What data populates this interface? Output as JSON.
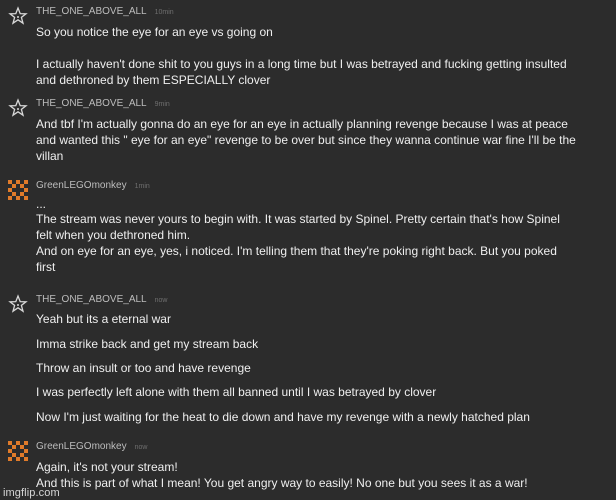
{
  "comments": [
    {
      "username": "THE_ONE_ABOVE_ALL",
      "time": "10min",
      "avatar_icon": "star-outline-icon",
      "lines": [
        "So you notice the eye for an eye vs going on",
        "I actually haven't done shit to you guys in a long time but I was betrayed and fucking getting insulted",
        "and dethroned by them ESPECIALLY clover"
      ]
    },
    {
      "username": "THE_ONE_ABOVE_ALL",
      "time": "9min",
      "avatar_icon": "star-outline-icon",
      "lines": [
        "And tbf I'm actually gonna do an eye for an eye in actually planning revenge because I was at peace",
        "and wanted this \" eye for an eye\" revenge to be over but since they wanna continue war fine I'll be the",
        "villan"
      ]
    },
    {
      "username": "GreenLEGOmonkey",
      "time": "1min",
      "avatar_icon": "pixel-avatar-icon",
      "lines": [
        "...",
        "The stream was never yours to begin with. It was started by Spinel. Pretty certain that's how Spinel",
        "felt when you dethroned him.",
        "And on eye for an eye, yes, i noticed. I'm telling them that they're poking right back. But you poked",
        "first"
      ]
    },
    {
      "username": "THE_ONE_ABOVE_ALL",
      "time": "now",
      "avatar_icon": "star-outline-icon",
      "lines": [
        "Yeah but its a eternal war",
        "Imma strike back and get my stream back",
        "Throw an insult or too and have revenge",
        "I was perfectly left alone with them all banned until I was betrayed by clover",
        "Now I'm just waiting for the heat to die down and have my revenge with a newly hatched plan"
      ]
    },
    {
      "username": "GreenLEGOmonkey",
      "time": "now",
      "avatar_icon": "pixel-avatar-icon",
      "lines": [
        "Again, it's not your stream!",
        "And this is part of what I mean! You get angry way to easily! No one but you sees it as a war!"
      ]
    }
  ],
  "watermark": "imgflip.com",
  "colors": {
    "background": "#2c2c2c",
    "username": "#bdbdbd",
    "timestamp": "#6f6f6f",
    "text": "#efefef",
    "pixel_avatar": "#e07b2a"
  }
}
